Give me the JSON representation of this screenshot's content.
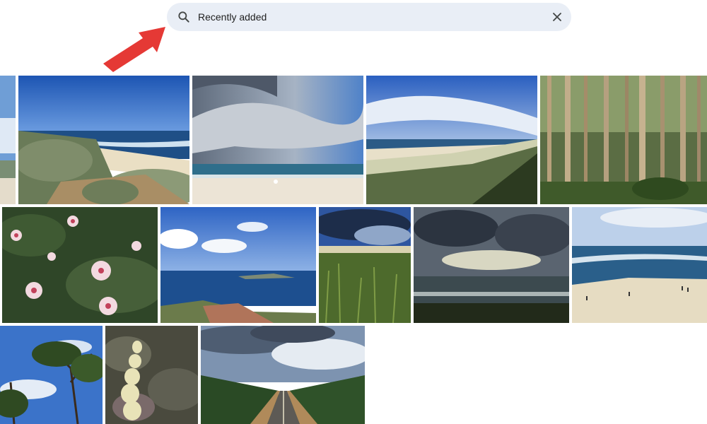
{
  "search": {
    "value": "Recently added",
    "search_icon": "search-icon",
    "clear_icon": "close-icon"
  },
  "annotation": {
    "icon": "arrow-icon",
    "color": "#e53935"
  },
  "colors": {
    "search_bg": "#e9eef6",
    "annotation": "#e53935"
  }
}
